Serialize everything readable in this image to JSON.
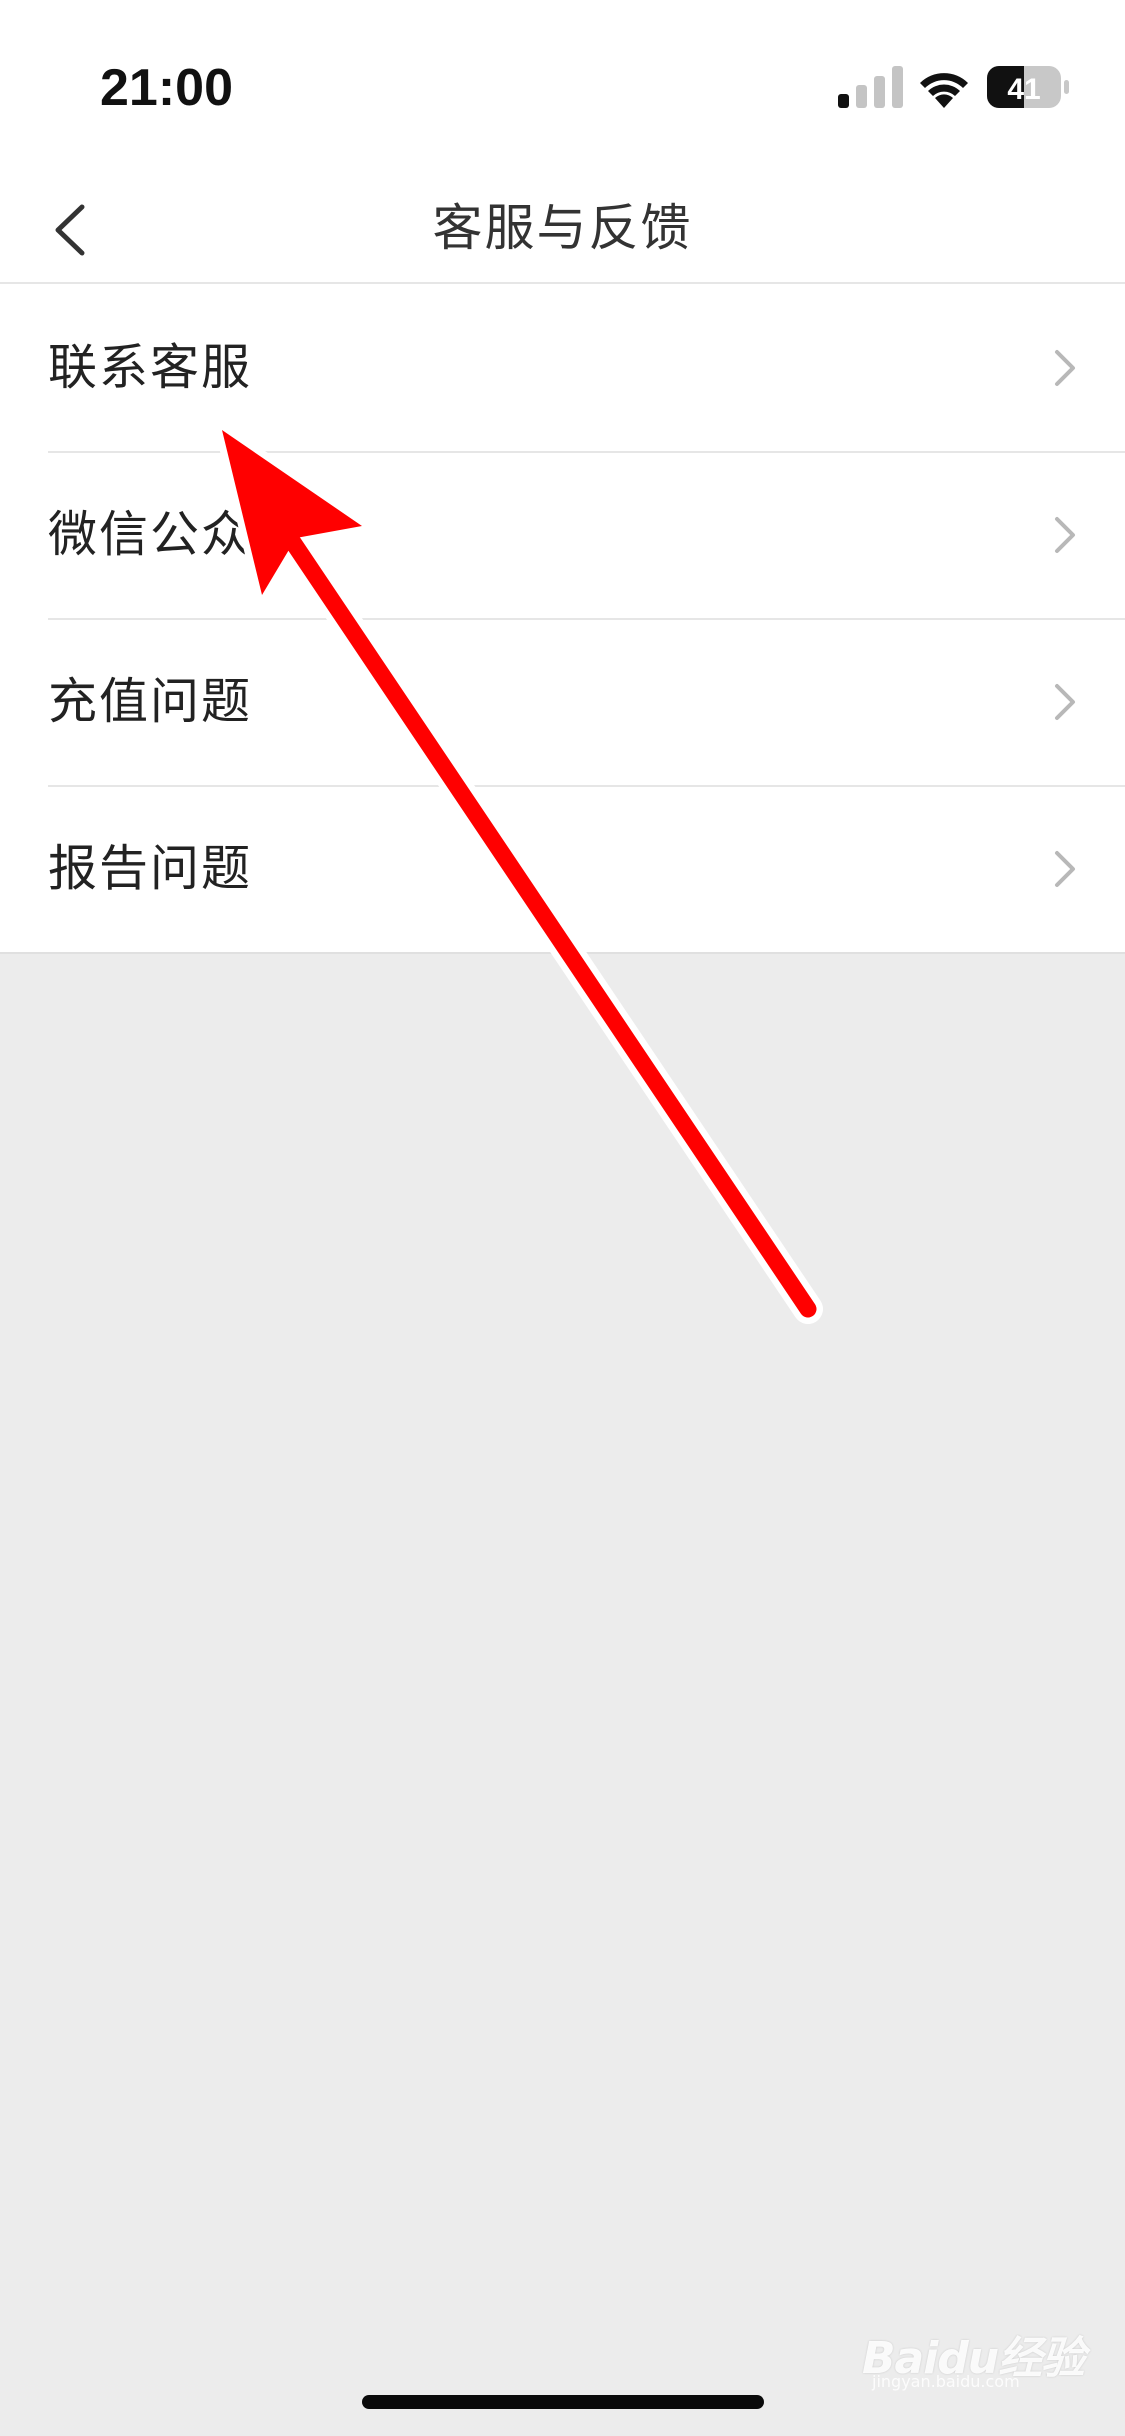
{
  "status_bar": {
    "time": "21:00",
    "battery_level": "41",
    "signal_icon": "cellular-signal-icon",
    "wifi_icon": "wifi-icon"
  },
  "nav": {
    "title": "客服与反馈",
    "back_icon": "chevron-left-icon"
  },
  "menu": {
    "items": [
      {
        "label": "联系客服"
      },
      {
        "label": "微信公众"
      },
      {
        "label": "充值问题"
      },
      {
        "label": "报告问题"
      }
    ],
    "chevron_icon": "chevron-right-icon"
  },
  "annotation": {
    "color": "#ff0000",
    "type": "red-arrow"
  },
  "watermark": {
    "text": "Baidu经验",
    "sub": "jingyan.baidu.com"
  },
  "colors": {
    "background": "#ececec",
    "surface": "#ffffff",
    "divider": "#e6e6e6",
    "text": "#222222",
    "chevron": "#b8b8b8"
  }
}
